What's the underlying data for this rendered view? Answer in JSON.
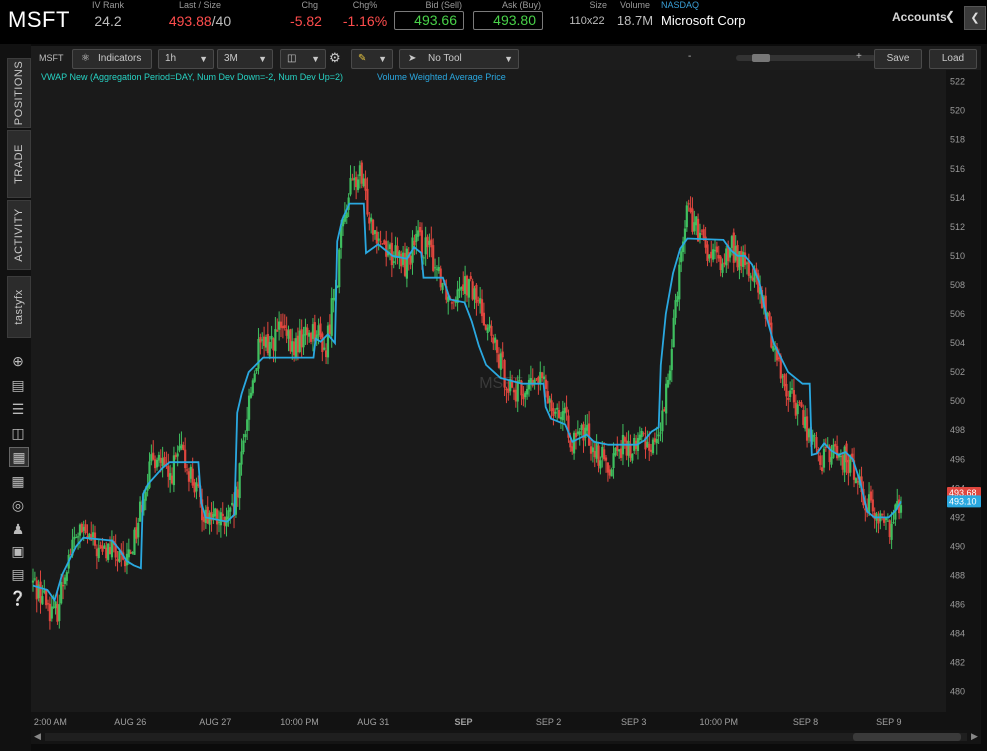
{
  "symbol": "MSFT",
  "quote": {
    "iv_rank": {
      "label": "IV Rank",
      "value": "24.2"
    },
    "last_size": {
      "label": "Last / Size",
      "last": "493.88",
      "size": "/40"
    },
    "chg": {
      "label": "Chg",
      "value": "-5.82"
    },
    "chg_pct": {
      "label": "Chg%",
      "value": "-1.16%"
    },
    "bid": {
      "label": "Bid (Sell)",
      "value": "493.66"
    },
    "ask": {
      "label": "Ask (Buy)",
      "value": "493.80"
    },
    "size": {
      "label": "Size",
      "value": "110x22"
    },
    "volume": {
      "label": "Volume",
      "value": "18.7M"
    },
    "exchange": {
      "label": "NASDAQ",
      "value": "Microsoft Corp"
    }
  },
  "accounts_label": "Accounts",
  "left_tabs": [
    "POSITIONS",
    "TRADE",
    "ACTIVITY",
    "tastyfx"
  ],
  "left_icons": [
    "crosshair-icon",
    "document-icon",
    "list-icon",
    "tv-icon",
    "chart-grid-icon",
    "layout-icon",
    "dashboard-icon",
    "people-icon",
    "calendar-icon",
    "news-icon",
    "help-icon"
  ],
  "toolbar": {
    "symbol": "MSFT",
    "indicators_label": "Indicators",
    "interval": "1h",
    "range": "3M",
    "tool": "No Tool",
    "zoom_minus": "-",
    "zoom_plus": "+",
    "save_label": "Save",
    "load_label": "Load"
  },
  "indicator_legend": {
    "vwap_text": "VWAP New (Aggregation Period=DAY, Num Dev Down=-2, Num Dev Up=2)",
    "vwap_desc": "Volume Weighted Average Price",
    "vwap_color": "#2aa8e0",
    "name_color": "#27d3c4"
  },
  "watermark": "MSFT",
  "colors": {
    "up": "#3fbf5f",
    "down": "#e0463e",
    "bg": "#1a1a1a",
    "last_tag": "#e0463e",
    "vwap_tag": "#2aa8e0"
  },
  "chart_data": {
    "type": "candlestick",
    "y_ticks": [
      522,
      520,
      518,
      516,
      514,
      512,
      510,
      508,
      506,
      504,
      502,
      500,
      498,
      496,
      494,
      492,
      490,
      488,
      486,
      484,
      482,
      480
    ],
    "ylim": [
      478.6,
      522.8
    ],
    "x_labels": [
      "2:00 AM",
      "AUG 26",
      "AUG 27",
      "10:00 PM",
      "AUG 31",
      "SEP",
      "SEP 2",
      "SEP 3",
      "10:00 PM",
      "SEP 8",
      "SEP 9"
    ],
    "last_price_tag": "493.68",
    "vwap_tag": "493.10",
    "price_path": [
      487.5,
      486.5,
      485.0,
      489.0,
      491.0,
      490.5,
      489.5,
      489.8,
      488.5,
      490.5,
      494.5,
      496.5,
      494.5,
      496.5,
      495.0,
      492.5,
      492.0,
      491.5,
      492.5,
      499.5,
      503.5,
      504.0,
      505.0,
      503.5,
      504.5,
      505.0,
      503.5,
      509.5,
      514.5,
      515.5,
      512.5,
      511.0,
      510.0,
      509.5,
      511.0,
      510.5,
      509.0,
      507.0,
      508.5,
      507.5,
      506.0,
      503.5,
      501.5,
      500.5,
      501.0,
      501.5,
      500.0,
      499.0,
      497.0,
      498.0,
      496.5,
      495.5,
      497.0,
      496.5,
      497.5,
      497.0,
      499.0,
      507.0,
      513.5,
      511.5,
      510.0,
      509.5,
      510.5,
      509.5,
      508.5,
      506.0,
      503.0,
      500.5,
      499.5,
      497.5,
      496.0,
      496.5,
      496.0,
      495.0,
      493.0,
      492.0,
      491.5,
      493.5
    ],
    "vwap_path": [
      [
        0,
        487.3
      ],
      [
        2,
        487.0
      ],
      [
        3,
        486.3
      ],
      [
        4,
        488.0
      ],
      [
        6,
        490.0
      ],
      [
        7,
        490.6
      ],
      [
        11,
        490.4
      ],
      [
        12,
        489.8
      ],
      [
        13,
        489.0
      ],
      [
        14,
        488.7
      ],
      [
        15,
        488.5
      ],
      [
        15.3,
        493.6
      ],
      [
        16,
        494.3
      ],
      [
        18,
        495.4
      ],
      [
        19,
        495.8
      ],
      [
        23,
        495.8
      ],
      [
        23.4,
        493.0
      ],
      [
        24,
        492.0
      ],
      [
        27,
        491.7
      ],
      [
        28,
        492.2
      ],
      [
        28.4,
        499.2
      ],
      [
        29,
        500.5
      ],
      [
        30,
        502.0
      ],
      [
        32,
        503.0
      ],
      [
        39,
        503.0
      ],
      [
        39.3,
        504.3
      ],
      [
        40,
        504.1
      ],
      [
        41,
        504.6
      ],
      [
        42,
        504.0
      ],
      [
        42.3,
        511.0
      ],
      [
        43,
        512.5
      ],
      [
        44,
        513.6
      ],
      [
        46,
        513.6
      ],
      [
        46.3,
        510.2
      ],
      [
        48,
        510.8
      ],
      [
        50,
        510.0
      ],
      [
        52,
        509.8
      ],
      [
        53,
        510.6
      ],
      [
        54,
        510.2
      ],
      [
        54.3,
        508.5
      ],
      [
        57,
        508.5
      ],
      [
        58,
        507.0
      ],
      [
        60,
        506.8
      ],
      [
        61,
        505.5
      ],
      [
        62,
        503.8
      ],
      [
        63,
        502.5
      ],
      [
        65,
        501.6
      ],
      [
        68,
        501.2
      ],
      [
        71,
        501.2
      ],
      [
        71.3,
        499.6
      ],
      [
        72,
        498.8
      ],
      [
        74,
        498.4
      ],
      [
        75,
        497.2
      ],
      [
        77,
        497.7
      ],
      [
        78,
        497.2
      ],
      [
        80,
        497.0
      ],
      [
        84,
        497.0
      ],
      [
        85,
        497.3
      ],
      [
        86,
        497.9
      ],
      [
        87,
        498.2
      ],
      [
        87.3,
        502.5
      ],
      [
        88,
        506.0
      ],
      [
        89,
        508.8
      ],
      [
        90,
        510.5
      ],
      [
        91,
        511.2
      ],
      [
        96,
        511.1
      ],
      [
        97,
        510.4
      ],
      [
        98,
        510.0
      ],
      [
        99,
        510.0
      ],
      [
        100,
        509.4
      ],
      [
        101,
        508.2
      ],
      [
        102,
        505.8
      ],
      [
        103,
        504.0
      ],
      [
        104,
        503.0
      ],
      [
        105,
        502.0
      ],
      [
        107,
        501.2
      ],
      [
        108,
        501.2
      ],
      [
        108.3,
        496.3
      ],
      [
        109,
        496.4
      ],
      [
        110,
        497.1
      ],
      [
        111,
        496.6
      ],
      [
        112,
        496.3
      ],
      [
        113,
        496.5
      ],
      [
        114,
        496.0
      ],
      [
        115,
        494.5
      ],
      [
        116,
        492.4
      ],
      [
        117,
        492.0
      ],
      [
        119,
        492.0
      ],
      [
        120,
        492.5
      ],
      [
        120.7,
        493.1
      ]
    ]
  }
}
